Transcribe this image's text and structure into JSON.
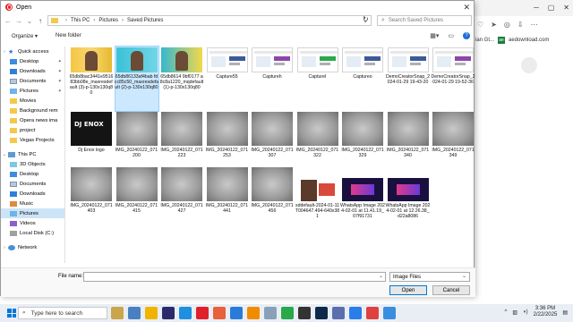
{
  "dialog": {
    "title": "Open",
    "close_glyph": "✕"
  },
  "address": {
    "crumbs": [
      "This PC",
      "Pictures",
      "Saved Pictures"
    ],
    "search_placeholder": "Search Saved Pictures"
  },
  "command_bar": {
    "organize": "Organize ▾",
    "new_folder": "New folder"
  },
  "nav": {
    "quick_access": "Quick access",
    "quick_items": [
      "Desktop",
      "Downloads",
      "Documents",
      "Pictures",
      "Movies",
      "Background rem",
      "Opera news ima",
      "project",
      "Vegas Projects"
    ],
    "this_pc": "This PC",
    "pc_items": [
      "3D Objects",
      "Desktop",
      "Documents",
      "Downloads",
      "Music",
      "Pictures",
      "Videos",
      "Local Disk (C:)"
    ],
    "network": "Network"
  },
  "files": [
    {
      "name": "65db8bac3441e951683bb08e_maxresdefault (3)-p-130x130q80",
      "thumb": "promo"
    },
    {
      "name": "65db86133af4bab fdcc85c50_maxresdefault (2)-p-130x130q80",
      "thumb": "promo2"
    },
    {
      "name": "65db8614 9bf0177 a8c8a1220_mqdefault (1)-p-130x130q80",
      "thumb": "promo3"
    },
    {
      "name": "Capture55",
      "thumb": "shot"
    },
    {
      "name": "Captureh",
      "thumb": "shot-purple"
    },
    {
      "name": "CaptureI",
      "thumb": "shot-green"
    },
    {
      "name": "Captureo",
      "thumb": "shot"
    },
    {
      "name": "DemoCreatorSnap_2024-01-29 19-43-20",
      "thumb": "shot"
    },
    {
      "name": "DemoCreatorSnap_2024-01-29 19-52-36",
      "thumb": "shot-purple"
    },
    {
      "name": "Dj Enox logo",
      "thumb": "dark",
      "label": "DJ ENOX"
    },
    {
      "name": "IMG_20240122_071200",
      "thumb": "paper"
    },
    {
      "name": "IMG_20240122_071223",
      "thumb": "paper"
    },
    {
      "name": "IMG_20240122_071253",
      "thumb": "paper"
    },
    {
      "name": "IMG_20240122_071307",
      "thumb": "paper"
    },
    {
      "name": "IMG_20240122_071322",
      "thumb": "paper"
    },
    {
      "name": "IMG_20240122_071329",
      "thumb": "paper"
    },
    {
      "name": "IMG_20240122_071340",
      "thumb": "paper"
    },
    {
      "name": "IMG_20240122_071349",
      "thumb": "paper"
    },
    {
      "name": "IMG_20240122_071403",
      "thumb": "paper"
    },
    {
      "name": "IMG_20240122_071415",
      "thumb": "paper"
    },
    {
      "name": "IMG_20240122_071427",
      "thumb": "paper"
    },
    {
      "name": "IMG_20240122_071441",
      "thumb": "paper"
    },
    {
      "name": "IMG_20240122_071456",
      "thumb": "paper"
    },
    {
      "name": "sddefault-2024-01-11T004647.494-640x381",
      "thumb": "mixed"
    },
    {
      "name": "WhatsApp Image 2024-02-01 at 11.41.19_07f91731",
      "thumb": "wa"
    },
    {
      "name": "WhatsApp Image 2024-02-01 at 12.26.38_d22a8086",
      "thumb": "wa"
    }
  ],
  "bottom": {
    "file_name_label": "File name:",
    "file_name_value": "",
    "filter": "Image Files",
    "open": "Open",
    "cancel": "Cancel"
  },
  "background_browser": {
    "bookmark_1": "ian Gt...",
    "bookmark_2": "aedownload.com"
  },
  "taskbar": {
    "search_placeholder": "Type here to search",
    "time": "3:36 PM",
    "date": "2/22/2025"
  }
}
